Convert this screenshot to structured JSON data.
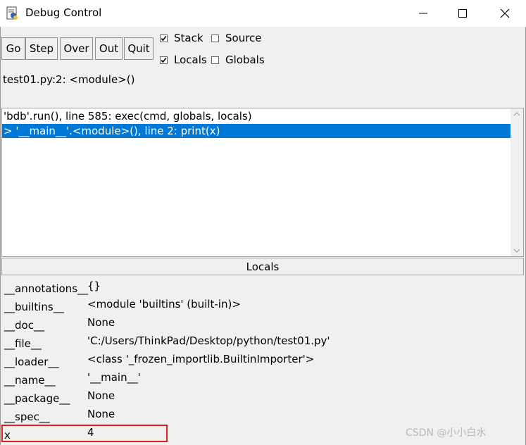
{
  "window": {
    "title": "Debug Control"
  },
  "toolbar": {
    "buttons": [
      "Go",
      "Step",
      "Over",
      "Out",
      "Quit"
    ],
    "checkboxes": [
      {
        "label": "Stack",
        "checked": true
      },
      {
        "label": "Source",
        "checked": false
      },
      {
        "label": "Locals",
        "checked": true
      },
      {
        "label": "Globals",
        "checked": false
      }
    ]
  },
  "status": {
    "text": "test01.py:2: <module>()"
  },
  "stack": {
    "rows": [
      {
        "text": "'bdb'.run(), line 585: exec(cmd, globals, locals)",
        "selected": false
      },
      {
        "text": "> '__main__'.<module>(), line 2: print(x)",
        "selected": true
      }
    ]
  },
  "locals": {
    "header": "Locals",
    "rows": [
      {
        "name": "__annotations__",
        "value": "{}"
      },
      {
        "name": "__builtins__",
        "value": "<module 'builtins' (built-in)>"
      },
      {
        "name": "__doc__",
        "value": "None"
      },
      {
        "name": "__file__",
        "value": "'C:/Users/ThinkPad/Desktop/python/test01.py'"
      },
      {
        "name": "__loader__",
        "value": "<class '_frozen_importlib.BuiltinImporter'>"
      },
      {
        "name": "__name__",
        "value": "'__main__'"
      },
      {
        "name": "__package__",
        "value": "None"
      },
      {
        "name": "__spec__",
        "value": "None"
      },
      {
        "name": "x",
        "value": "4"
      }
    ]
  },
  "highlight": {
    "color": "#e02020"
  },
  "selection_color": "#0078d7",
  "watermark": "CSDN @小小白水"
}
